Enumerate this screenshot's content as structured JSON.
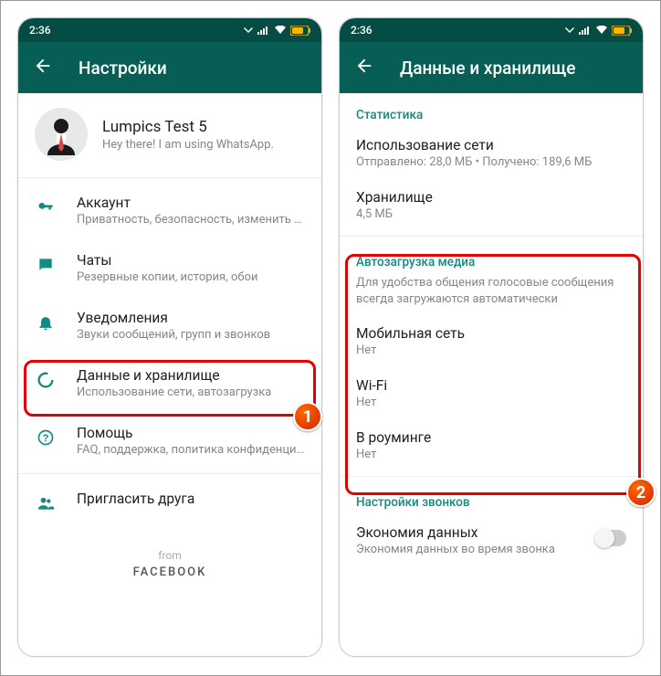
{
  "status": {
    "time": "2:36"
  },
  "phone1": {
    "appbar_title": "Настройки",
    "profile": {
      "name": "Lumpics Test 5",
      "status": "Hey there! I am using WhatsApp."
    },
    "items": [
      {
        "title": "Аккаунт",
        "sub": "Приватность, безопасность, изменить номер"
      },
      {
        "title": "Чаты",
        "sub": "Резервные копии, история, обои"
      },
      {
        "title": "Уведомления",
        "sub": "Звуки сообщений, групп и звонков"
      },
      {
        "title": "Данные и хранилище",
        "sub": "Использование сети, автозагрузка"
      },
      {
        "title": "Помощь",
        "sub": "FAQ, поддержка, политика конфиденциальн..."
      },
      {
        "title": "Пригласить друга",
        "sub": ""
      }
    ],
    "from": "from",
    "facebook": "FACEBOOK"
  },
  "phone2": {
    "appbar_title": "Данные и хранилище",
    "sections": {
      "stats_label": "Статистика",
      "net_usage_title": "Использование сети",
      "net_usage_sub": "Отправлено: 28,0 МБ • Получено: 189,6 МБ",
      "storage_title": "Хранилище",
      "storage_sub": "4,5 МБ",
      "autoload_label": "Автозагрузка медиа",
      "autoload_desc": "Для удобства общения голосовые сообщения всегда загружаются автоматически",
      "mobile_title": "Мобильная сеть",
      "mobile_sub": "Нет",
      "wifi_title": "Wi-Fi",
      "wifi_sub": "Нет",
      "roaming_title": "В роуминге",
      "roaming_sub": "Нет",
      "calls_label": "Настройки звонков",
      "data_saver_title": "Экономия данных",
      "data_saver_sub": "Экономия данных во время звонка"
    }
  },
  "badges": {
    "one": "1",
    "two": "2"
  }
}
